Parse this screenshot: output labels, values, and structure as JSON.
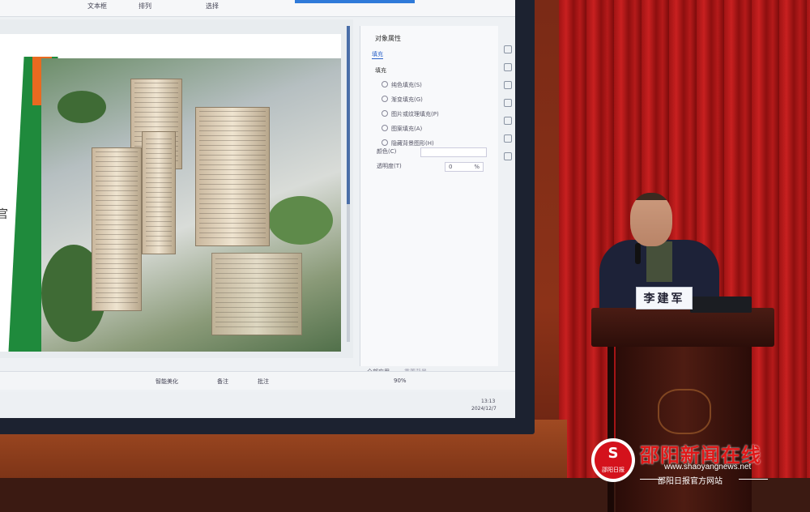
{
  "screen": {
    "toolbar": {
      "text_box": "文本框",
      "arrange": "排列",
      "select": "选择"
    },
    "panel": {
      "title": "对象属性",
      "tab": "填充",
      "section": "填充",
      "options": [
        "纯色填充(S)",
        "渐变填充(G)",
        "图片或纹理填充(P)",
        "图案填充(A)",
        "隐藏背景图形(H)"
      ],
      "color_label": "颜色(C)",
      "transparency_label": "透明度(T)",
      "transparency_value": "0",
      "transparency_unit": "%",
      "apply_all": "全部应用",
      "reset_bg": "重置背景"
    },
    "statusbar": {
      "smart_beautify": "智能美化",
      "notes": "备注",
      "comments": "批注",
      "zoom": "90%"
    },
    "taskbar": {
      "time": "13:13",
      "date": "2024/12/7"
    }
  },
  "nameplate": "李建军",
  "watermark": {
    "title": "邵阳新闻在线",
    "url": "www.shaoyangnews.net",
    "subtitle": "邵阳日报官方网站",
    "logo_glyph": "S",
    "logo_text": "邵阳日报"
  },
  "colors": {
    "curtain": "#b51a1a",
    "watermark_red": "#e01818",
    "slide_green": "#1f8a3c",
    "slide_orange": "#e86a20"
  }
}
